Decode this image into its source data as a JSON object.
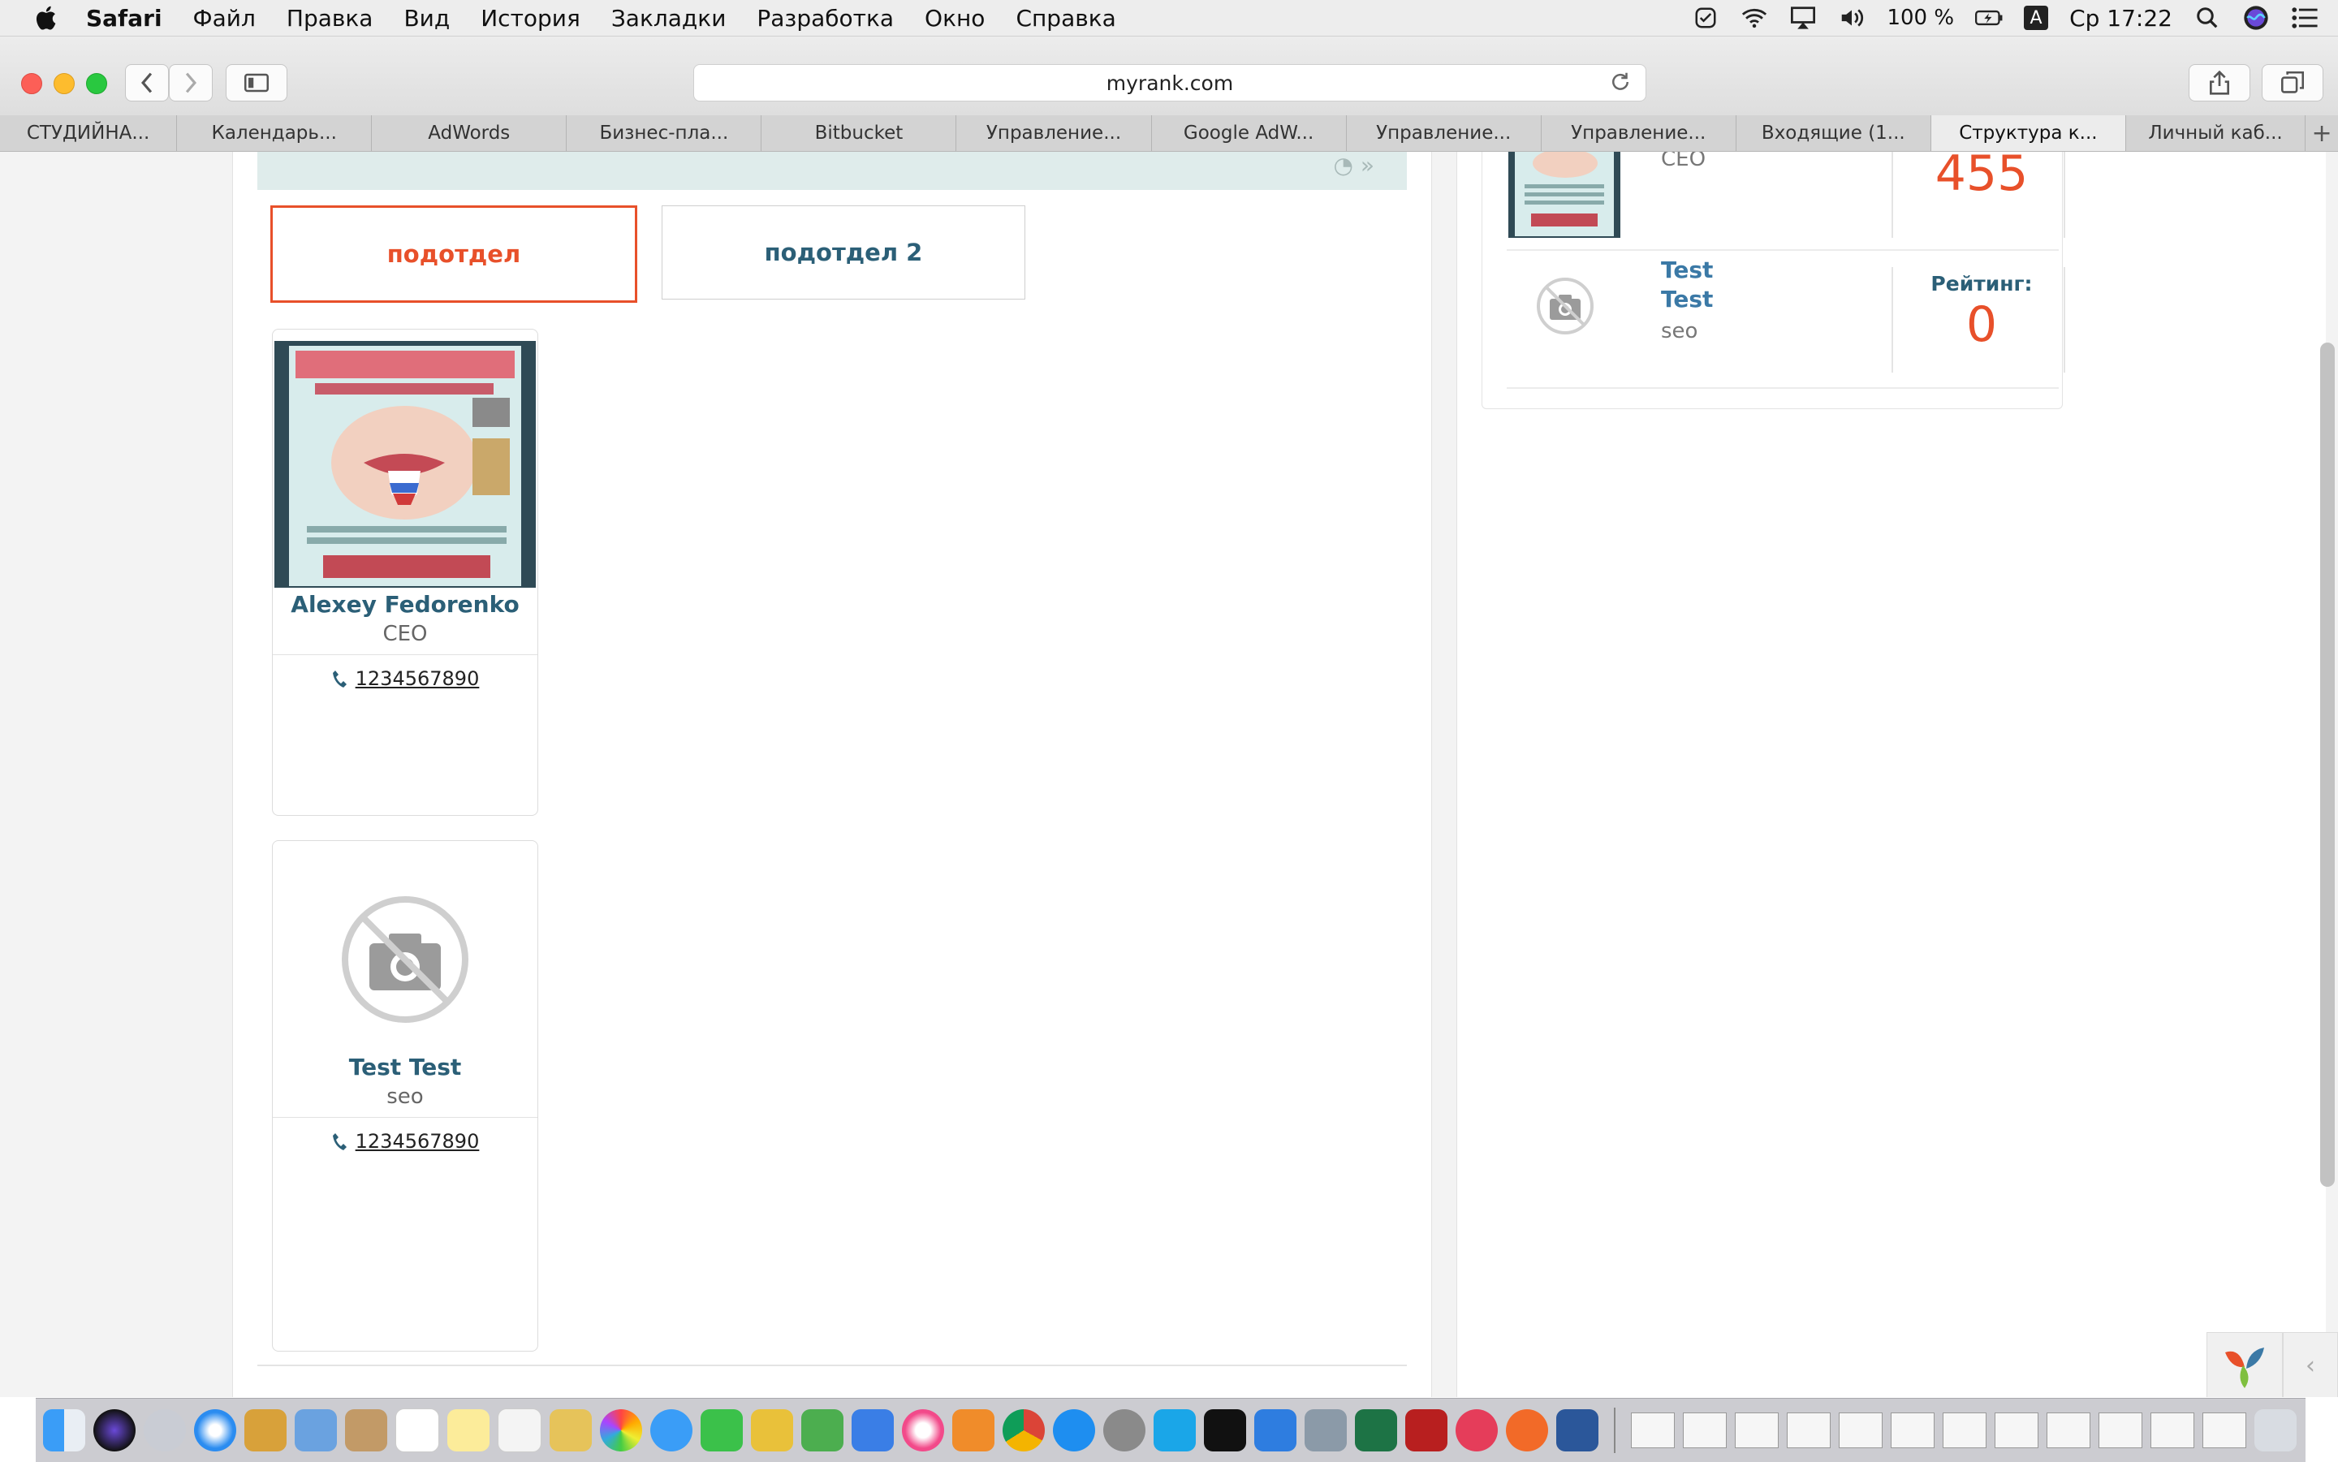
{
  "menubar": {
    "app_name": "Safari",
    "items": [
      "Файл",
      "Правка",
      "Вид",
      "История",
      "Закладки",
      "Разработка",
      "Окно",
      "Справка"
    ],
    "battery": "100 %",
    "input_source": "A",
    "clock": "Ср 17:22",
    "icons": [
      "apple-icon",
      "checkmark-status-icon",
      "wifi-icon",
      "airplay-icon",
      "volume-icon",
      "battery-icon",
      "search-icon",
      "siri-icon",
      "notification-center-icon"
    ]
  },
  "browser": {
    "url": "myrank.com",
    "tabs": [
      {
        "label": "СТУДИЙНА...",
        "active": false
      },
      {
        "label": "Календарь...",
        "active": false
      },
      {
        "label": "AdWords",
        "active": false
      },
      {
        "label": "Бизнес-пла...",
        "active": false
      },
      {
        "label": "Bitbucket",
        "active": false
      },
      {
        "label": "Управление...",
        "active": false
      },
      {
        "label": "Google AdW...",
        "active": false
      },
      {
        "label": "Управление...",
        "active": false
      },
      {
        "label": "Управление...",
        "active": false
      },
      {
        "label": "Входящие (1...",
        "active": false
      },
      {
        "label": "Структура к...",
        "active": true
      },
      {
        "label": "Личный каб...",
        "active": false
      }
    ],
    "new_tab": "+"
  },
  "subtabs": [
    {
      "label": "подотдел",
      "active": true
    },
    {
      "label": "подотдел 2",
      "active": false
    }
  ],
  "employees": [
    {
      "name": "Alexey Fedorenko",
      "role": "CEO",
      "phone": "1234567890",
      "photo": "photo"
    },
    {
      "name": "Test Test",
      "role": "seo",
      "phone": "1234567890",
      "photo": "no-photo-icon"
    }
  ],
  "sidebar": {
    "rows": [
      {
        "first": "",
        "last": "",
        "role": "CEO",
        "rating_label": "",
        "rating_value": "455"
      },
      {
        "first": "Test",
        "last": "Test",
        "role": "seo",
        "rating_label": "Рейтинг:",
        "rating_value": "0"
      }
    ]
  },
  "colors": {
    "accent": "#e8502a",
    "name_text": "#2b5f77",
    "link_blue": "#3b79a6",
    "header_band": "#dfeceb"
  }
}
